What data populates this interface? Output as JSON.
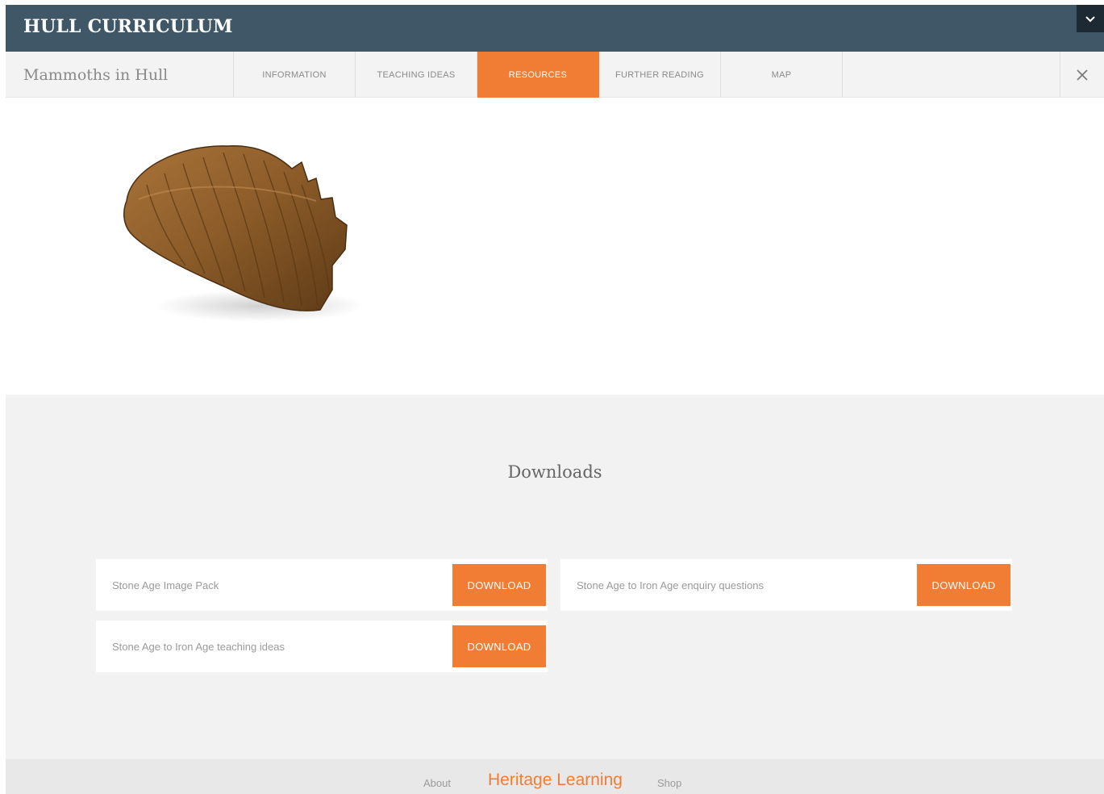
{
  "header": {
    "title": "HULL CURRICULUM",
    "collapse_icon": "chevron-down-icon"
  },
  "subnav": {
    "title": "Mammoths in Hull",
    "tabs": [
      {
        "label": "INFORMATION",
        "active": false
      },
      {
        "label": "TEACHING IDEAS",
        "active": false
      },
      {
        "label": "RESOURCES",
        "active": true
      },
      {
        "label": "FURTHER READING",
        "active": false
      },
      {
        "label": "MAP",
        "active": false
      }
    ],
    "close_icon": "close-icon"
  },
  "hero": {
    "image": "mammoth-tooth-image"
  },
  "downloads": {
    "title": "Downloads",
    "items": [
      {
        "name": "Stone Age Image Pack",
        "button": "DOWNLOAD"
      },
      {
        "name": "Stone Age to Iron Age enquiry questions",
        "button": "DOWNLOAD"
      },
      {
        "name": "Stone Age to Iron Age teaching ideas",
        "button": "DOWNLOAD"
      }
    ]
  },
  "footer": {
    "about": "About",
    "brand": "Heritage Learning",
    "shop": "Shop"
  },
  "colors": {
    "header": "#3f5766",
    "accent": "#f07d33",
    "panel": "#f2f2f2"
  }
}
